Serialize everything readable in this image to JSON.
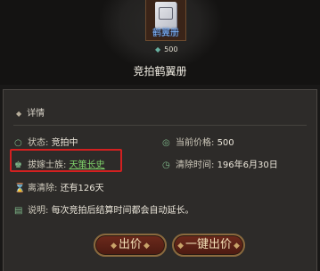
{
  "item": {
    "name": "鹤翼册",
    "price": "500",
    "title": "竞拍鹤翼册"
  },
  "panel": {
    "header": "详情",
    "status_label": "状态:",
    "status_value": "竞拍中",
    "current_price_label": "当前价格:",
    "current_price_value": "500",
    "bidder_label": "拔嫁士族:",
    "bidder_value": "天策长史",
    "clear_time_label": "清除时间:",
    "clear_time_value": "196年6月30日",
    "remaining_label": "离清除:",
    "remaining_value": "还有126天",
    "note_label": "说明:",
    "note_value": "每次竞拍后结算时间都会自动延长。"
  },
  "buttons": {
    "bid": "出价",
    "one_click_bid": "一键出价"
  },
  "colors": {
    "highlight": "#d22020",
    "link": "#7fd36a",
    "item_name": "#7fb8ff"
  }
}
